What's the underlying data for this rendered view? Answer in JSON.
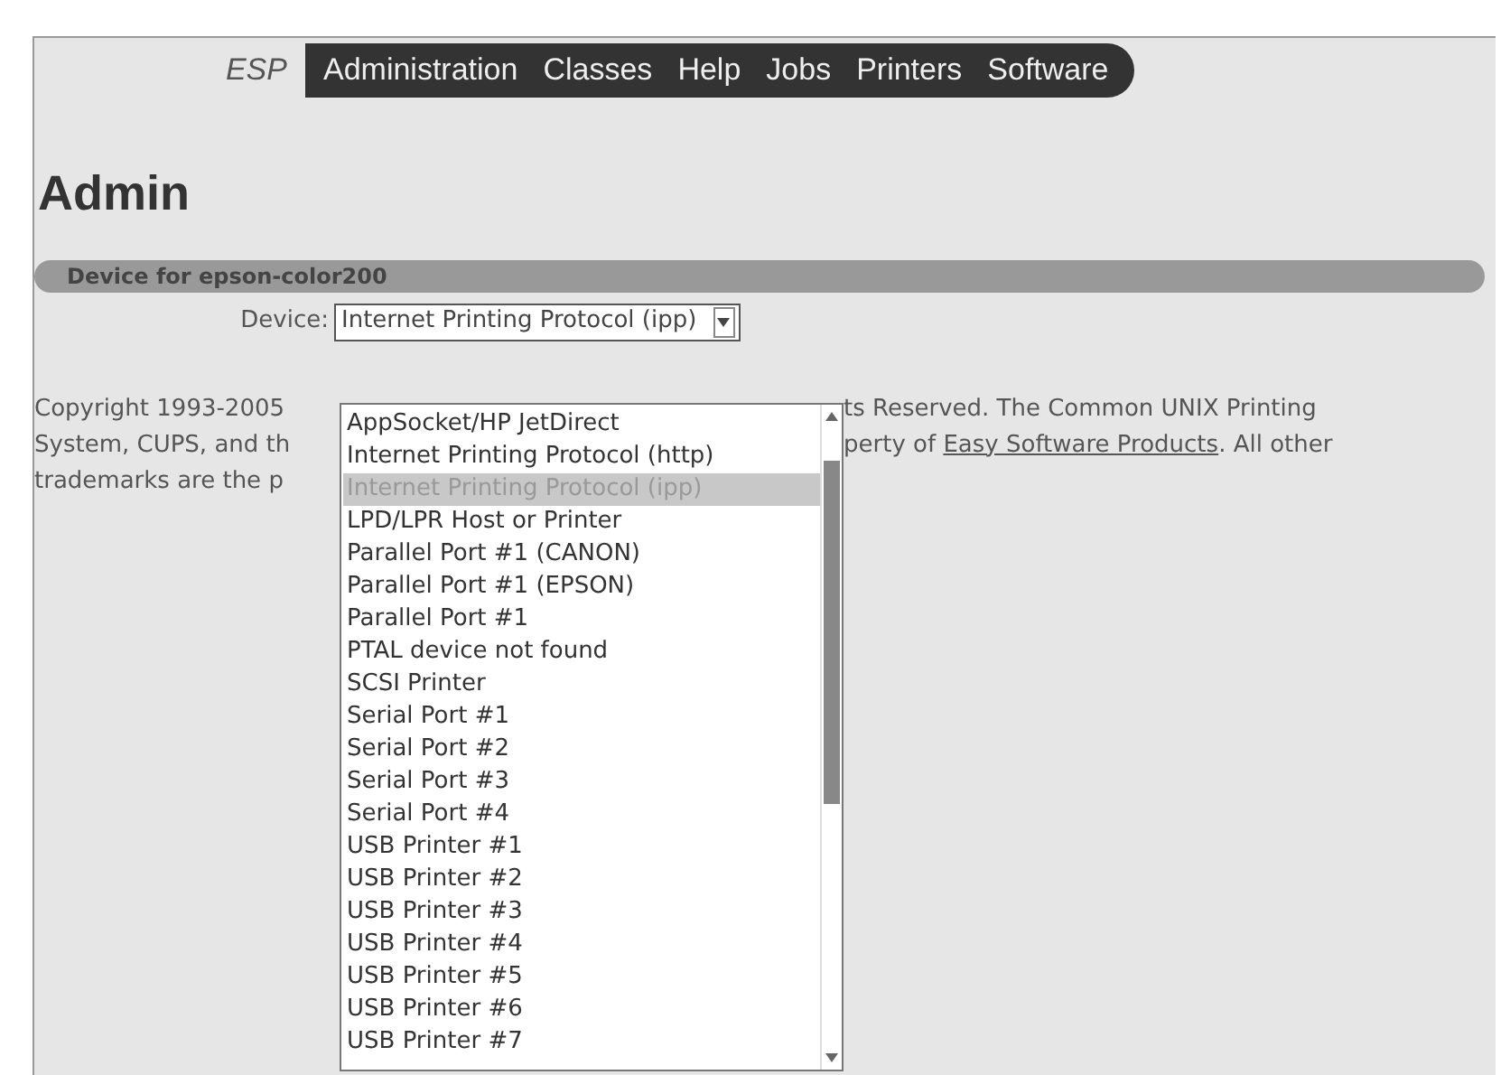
{
  "nav": {
    "brand": "ESP",
    "items": [
      "Administration",
      "Classes",
      "Help",
      "Jobs",
      "Printers",
      "Software"
    ]
  },
  "heading": "Admin",
  "section": {
    "title": "Device for epson-color200"
  },
  "device": {
    "label": "Device:",
    "value": "Internet Printing Protocol (ipp)",
    "expanded": true,
    "options": [
      {
        "label": "AppSocket/HP JetDirect",
        "selected": false
      },
      {
        "label": "Internet Printing Protocol (http)",
        "selected": false
      },
      {
        "label": "Internet Printing Protocol (ipp)",
        "selected": true
      },
      {
        "label": "LPD/LPR Host or Printer",
        "selected": false
      },
      {
        "label": "Parallel Port #1 (CANON)",
        "selected": false
      },
      {
        "label": "Parallel Port #1 (EPSON)",
        "selected": false
      },
      {
        "label": "Parallel Port #1",
        "selected": false
      },
      {
        "label": "PTAL device not found",
        "selected": false
      },
      {
        "label": "SCSI Printer",
        "selected": false
      },
      {
        "label": "Serial Port #1",
        "selected": false
      },
      {
        "label": "Serial Port #2",
        "selected": false
      },
      {
        "label": "Serial Port #3",
        "selected": false
      },
      {
        "label": "Serial Port #4",
        "selected": false
      },
      {
        "label": "USB Printer #1",
        "selected": false
      },
      {
        "label": "USB Printer #2",
        "selected": false
      },
      {
        "label": "USB Printer #3",
        "selected": false
      },
      {
        "label": "USB Printer #4",
        "selected": false
      },
      {
        "label": "USB Printer #5",
        "selected": false
      },
      {
        "label": "USB Printer #6",
        "selected": false
      },
      {
        "label": "USB Printer #7",
        "selected": false
      }
    ]
  },
  "footer": {
    "left_lines": [
      "Copyright 1993-2005",
      "System, CUPS, and th",
      "trademarks are the p"
    ],
    "right_line_1": "ts Reserved. The Common UNIX Printing",
    "right_line_2_before": "perty of",
    "right_line_2_link": "Easy Software Products",
    "right_line_2_after": ". All other"
  }
}
